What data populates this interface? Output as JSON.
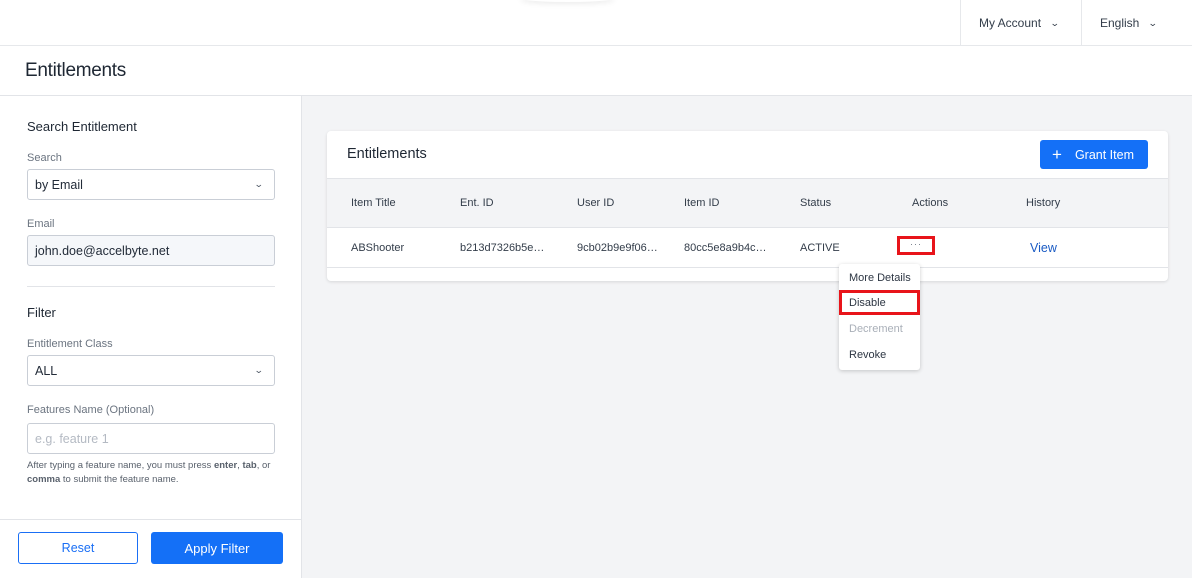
{
  "topnav": {
    "account_label": "My Account",
    "language_label": "English"
  },
  "page": {
    "title": "Entitlements"
  },
  "sidebar": {
    "search_heading": "Search Entitlement",
    "search_label": "Search",
    "search_by_value": "by Email",
    "email_label": "Email",
    "email_value": "john.doe@accelbyte.net",
    "filter_heading": "Filter",
    "entitlement_class_label": "Entitlement Class",
    "entitlement_class_value": "ALL",
    "features_label": "Features Name (Optional)",
    "features_placeholder": "e.g. feature 1",
    "help_prefix": "After typing a feature name, you must press ",
    "help_enter": "enter",
    "help_sep1": ", ",
    "help_tab": "tab",
    "help_sep2": ", or ",
    "help_comma": "comma",
    "help_suffix": " to submit the feature name.",
    "reset_label": "Reset",
    "apply_label": "Apply Filter"
  },
  "card": {
    "title": "Entitlements",
    "grant_label": "Grant Item",
    "grant_icon": "+",
    "columns": [
      "Item Title",
      "Ent. ID",
      "User ID",
      "Item ID",
      "Status",
      "Actions",
      "History"
    ],
    "rows": [
      {
        "item_title": "ABShooter",
        "ent_id": "b213d7326b5e…",
        "user_id": "9cb02b9e9f06…",
        "item_id": "80cc5e8a9b4c…",
        "status": "ACTIVE",
        "actions": "···",
        "history": "View"
      }
    ]
  },
  "actions_menu": {
    "items": [
      {
        "label": "More Details",
        "disabled": false
      },
      {
        "label": "Disable",
        "disabled": false,
        "highlighted": true
      },
      {
        "label": "Decrement",
        "disabled": true
      },
      {
        "label": "Revoke",
        "disabled": false
      }
    ]
  },
  "colors": {
    "primary": "#1470f7",
    "highlight_border": "#e8141a",
    "link": "#1a5bc4"
  }
}
